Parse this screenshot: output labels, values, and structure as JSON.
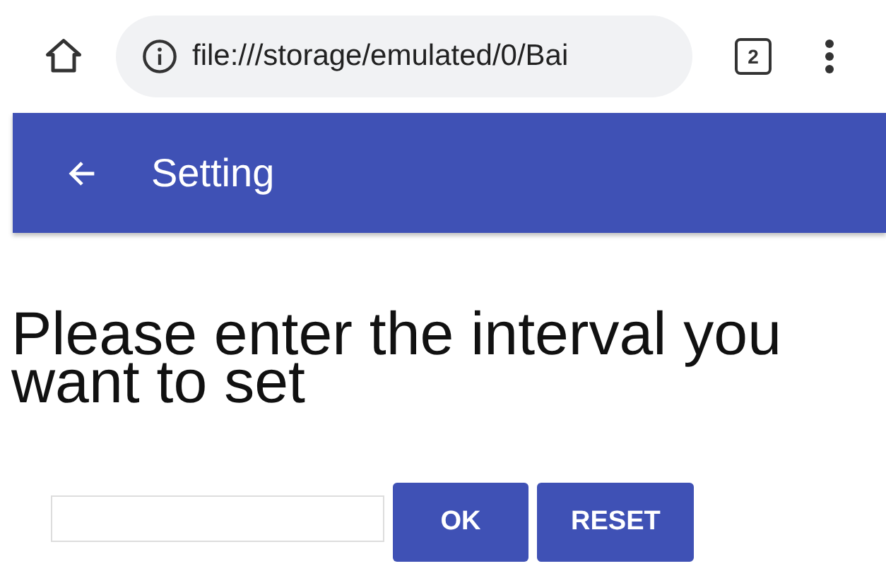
{
  "browser": {
    "url": "file:///storage/emulated/0/Bai",
    "tab_count": "2"
  },
  "app_bar": {
    "title": "Setting"
  },
  "prompt": "Please enter the interval you want to set",
  "buttons": [
    "OK",
    "RESET"
  ]
}
